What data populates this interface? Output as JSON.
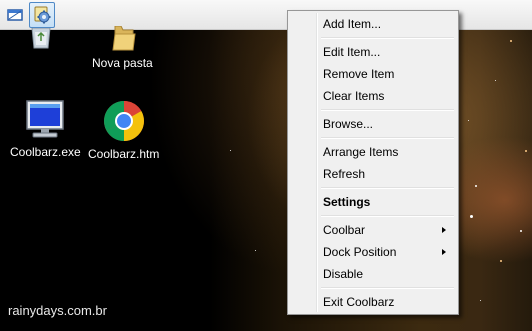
{
  "desktop": {
    "icons": [
      {
        "label": "",
        "icon": "recycle-bin-icon"
      },
      {
        "label": "Nova pasta",
        "icon": "folder-icon"
      },
      {
        "label": "Coolbarz.exe",
        "icon": "monitor-app-icon"
      },
      {
        "label": "Coolbarz.htm",
        "icon": "chrome-icon"
      }
    ],
    "watermark": "rainydays.com.br"
  },
  "coolbar": {
    "buttons": [
      {
        "icon": "window-icon"
      },
      {
        "icon": "settings-gear-icon"
      }
    ]
  },
  "menu": {
    "items": [
      {
        "label": "Add Item..."
      },
      {
        "label": "Edit Item..."
      },
      {
        "label": "Remove Item"
      },
      {
        "label": "Clear Items"
      },
      {
        "label": "Browse..."
      },
      {
        "label": "Arrange Items"
      },
      {
        "label": "Refresh"
      },
      {
        "label": "Settings",
        "bold": true
      },
      {
        "label": "Coolbar",
        "submenu": true
      },
      {
        "label": "Dock Position",
        "submenu": true
      },
      {
        "label": "Disable"
      },
      {
        "label": "Exit Coolbarz"
      }
    ]
  }
}
